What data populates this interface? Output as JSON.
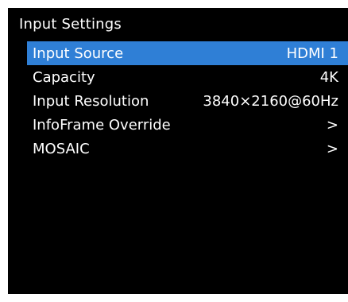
{
  "title": "Input Settings",
  "accent_color": "#2f7fd6",
  "menu": {
    "items": [
      {
        "label": "Input Source",
        "value": "HDMI 1",
        "selected": true
      },
      {
        "label": "Capacity",
        "value": "4K"
      },
      {
        "label": "Input Resolution",
        "value": "3840×2160@60Hz"
      },
      {
        "label": "InfoFrame Override",
        "value": ">"
      },
      {
        "label": "MOSAIC",
        "value": ">"
      }
    ]
  }
}
